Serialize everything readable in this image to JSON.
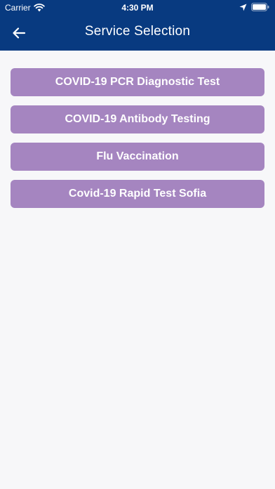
{
  "status_bar": {
    "carrier": "Carrier",
    "time": "4:30 PM"
  },
  "header": {
    "title": "Service Selection",
    "back_icon": "arrow-left-icon",
    "background_color": "#083a80"
  },
  "services": [
    {
      "label": "COVID-19 PCR Diagnostic Test"
    },
    {
      "label": "COVID-19 Antibody Testing"
    },
    {
      "label": "Flu Vaccination"
    },
    {
      "label": "Covid-19 Rapid Test Sofia"
    }
  ],
  "colors": {
    "button": "#a585c0",
    "page_background": "#f7f7f9"
  }
}
